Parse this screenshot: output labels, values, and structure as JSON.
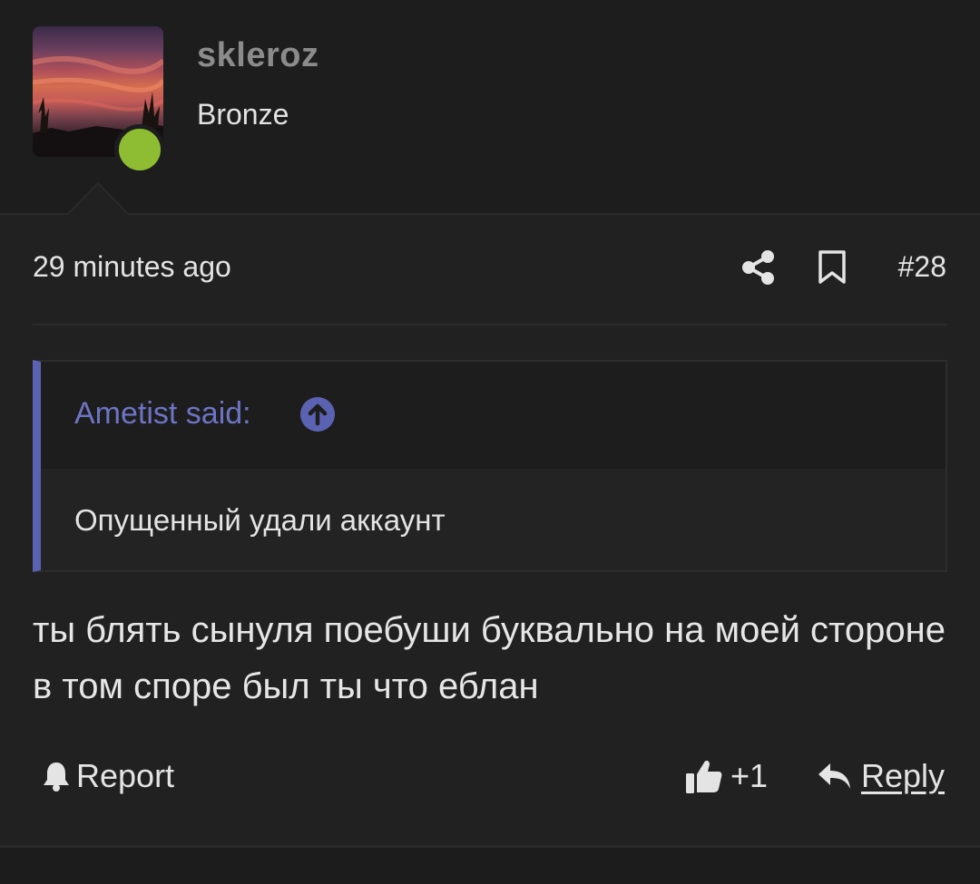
{
  "user": {
    "name": "skleroz",
    "rank": "Bronze",
    "online": true,
    "status_color": "#8ebd33"
  },
  "post": {
    "time": "29 minutes ago",
    "number": "#28",
    "icons": [
      "share-icon",
      "bookmark-icon"
    ]
  },
  "quote": {
    "author": "Ametist said:",
    "text": "Опущенный удали аккаунт",
    "accent_color": "#5b62b1"
  },
  "message": "ты блять сынуля поебуши буквально на моей стороне в том споре был ты что еблан",
  "actions": {
    "report_label": "Report",
    "like_count": "+1",
    "reply_label": "Reply"
  }
}
